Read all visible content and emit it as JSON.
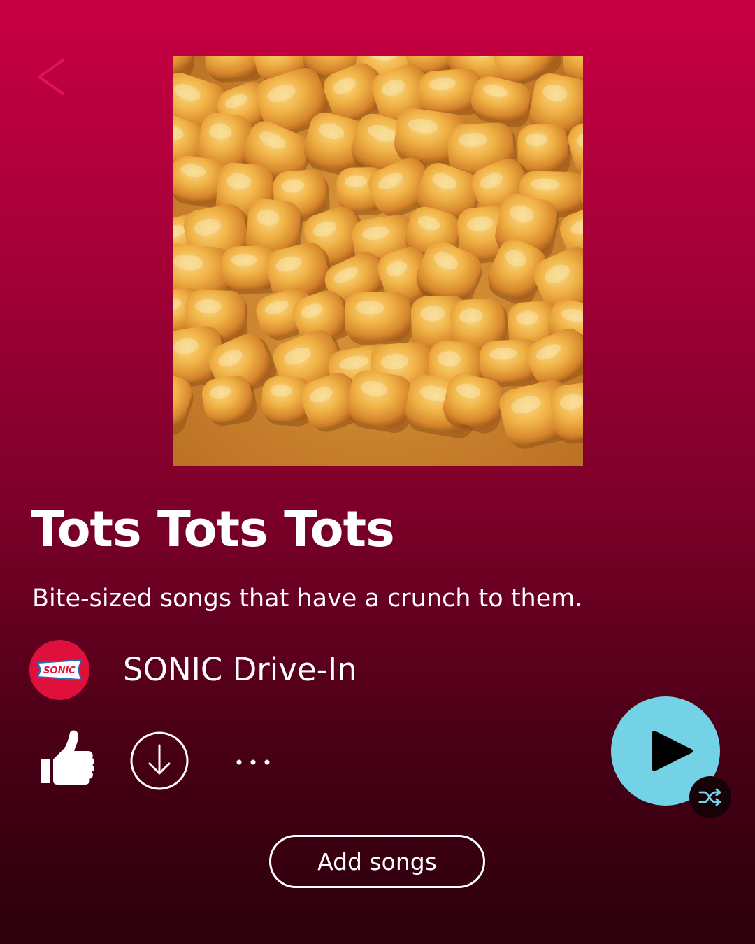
{
  "header": {
    "back_icon": "chevron-left-icon",
    "back_color": "#e0135a"
  },
  "playlist": {
    "cover_image": "tater-tots-photo",
    "title": "Tots Tots Tots",
    "description": "Bite-sized songs that have a crunch to them.",
    "creator": {
      "name": "SONIC Drive-In",
      "logo_text": "SONIC",
      "avatar_color": "#e0103d"
    }
  },
  "actions": {
    "like_icon": "thumbs-up-icon",
    "download_icon": "download-icon",
    "more_icon": "more-icon",
    "play_icon": "play-icon",
    "shuffle_icon": "shuffle-icon",
    "play_button_color": "#74d2e7",
    "add_songs_label": "Add songs"
  }
}
